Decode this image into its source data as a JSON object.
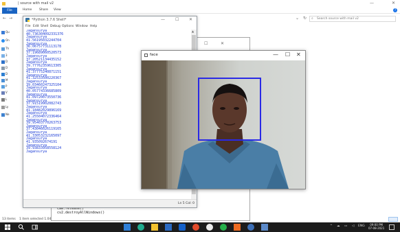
{
  "explorer": {
    "title": "| source with mail v2",
    "ribbon_tabs": [
      "File",
      "Home",
      "Share",
      "View"
    ],
    "search_placeholder": "Search source with mail v2",
    "nav_items": [
      "Qu",
      "On",
      "Th",
      "3",
      "D",
      "D",
      "D",
      "M",
      "P",
      "V",
      "L",
      "Ly",
      "Ne"
    ],
    "status_count": "13 items",
    "status_selected": "1 item selected 1.04",
    "help_label": "?"
  },
  "shell": {
    "title": "*Python 3.7.6 Shell*",
    "menu": [
      "File",
      "Edit",
      "Shell",
      "Debug",
      "Options",
      "Window",
      "Help"
    ],
    "lines": [
      "Jagansurya",
      "40.736304092331376",
      "Jagansurya",
      "41.56195032244704",
      "Jagansurya",
      "36.06757731113178",
      "Jagansurya",
      "37.19689060520573",
      "Jagansurya",
      "37.20521134435152",
      "Jagansurya",
      "39.77762359613305",
      "Jagansurya",
      "41.37775240871151",
      "Jagansurya",
      "41.32533500220367",
      "Jagansurya",
      "39.03460247325104",
      "Jagansurya",
      "40.05774336685809",
      "Jagansurya",
      "41.09720073550736",
      "Jagansurya",
      "37.91519902082743",
      "Jagansurya",
      "41.18482029896169",
      "Jagansurya",
      "41.25504072336464",
      "Jagansurya",
      "39.95403770263753",
      "Jagansurya",
      "37.43046026119165",
      "Jagansurya",
      "41.33053232165097",
      "Jagansurya",
      "41.935092674191",
      "Jagansurya",
      "39.93833958558124",
      "Jagansurya"
    ],
    "status": "Ln 5 Col: 0"
  },
  "code_window": {
    "lines": [
      "cam.release()",
      "cv2.destroyAllWindows()"
    ]
  },
  "face_window": {
    "title": "face",
    "box_color": "#2929e6"
  },
  "window_controls": {
    "minimize": "—",
    "maximize": "☐",
    "close": "✕"
  },
  "taskbar": {
    "clock_time": "09:00 PM",
    "clock_date": "07-08-2021",
    "lang": "ENG",
    "tray_arrow": "^"
  }
}
